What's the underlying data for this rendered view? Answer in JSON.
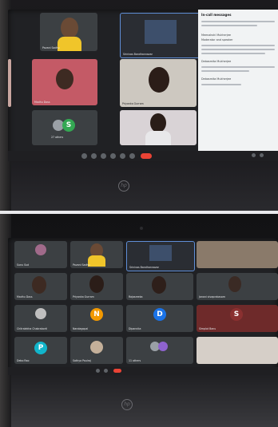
{
  "top_call": {
    "participants": [
      {
        "name": "Pavani Sadhu"
      },
      {
        "name": "Srinivas Bandhannavar"
      },
      {
        "name": "Madhu Doss"
      },
      {
        "name": "Priyanka Gurram"
      }
    ],
    "others_label": "27 others",
    "others_avatar_letter": "S",
    "chat": {
      "title": "In-call messages",
      "lines": [
        "Meenakshi Mukherjee",
        "Moderator and speaker",
        "Debasmita Mukherjee",
        "Debasmita Mukherjee"
      ]
    }
  },
  "bottom_call": {
    "participants": [
      {
        "name": "Sunu Sud"
      },
      {
        "name": "Pavani Sadhu"
      },
      {
        "name": "Srinivas Bandhannavar"
      },
      {
        "name": "Madhu Doss"
      },
      {
        "name": "Priyanka Gurram"
      },
      {
        "name": "Rajasreeka"
      },
      {
        "name": "Janani sivaprakasam"
      },
      {
        "name": "Chitralekha Chakraborti"
      },
      {
        "name": "Nandagopal",
        "letter": "N"
      },
      {
        "name": "Dipannita",
        "letter": "D"
      },
      {
        "name": "Simplot Banu",
        "letter": "S"
      },
      {
        "name": "Debo Rao",
        "letter": "P"
      },
      {
        "name": "Sathya Paulraj"
      },
      {
        "name": "11 others"
      }
    ]
  },
  "laptop_logo": "hp",
  "colors": {
    "meet_dark": "#202124",
    "tile": "#3c4043",
    "avatar_green": "#34a853",
    "avatar_orange": "#f29900",
    "avatar_blue": "#1a73e8",
    "end_call": "#ea4335"
  }
}
